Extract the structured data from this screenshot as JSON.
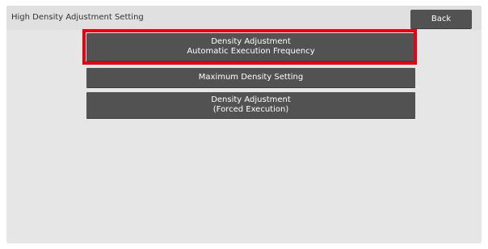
{
  "header": {
    "title": "High Density Adjustment Setting",
    "back_label": "Back"
  },
  "menu": {
    "items": [
      {
        "line1": "Density Adjustment",
        "line2": "Automatic Execution Frequency"
      },
      {
        "line1": "Maximum Density Setting"
      },
      {
        "line1": "Density Adjustment",
        "line2": "(Forced Execution)"
      }
    ]
  },
  "highlight": {
    "color": "#e60012",
    "target": "Density Adjustment Automatic Execution Frequency"
  },
  "colors": {
    "button_bg": "#525252",
    "screen_bg": "#e6e6e6",
    "text_light": "#ffffff"
  }
}
